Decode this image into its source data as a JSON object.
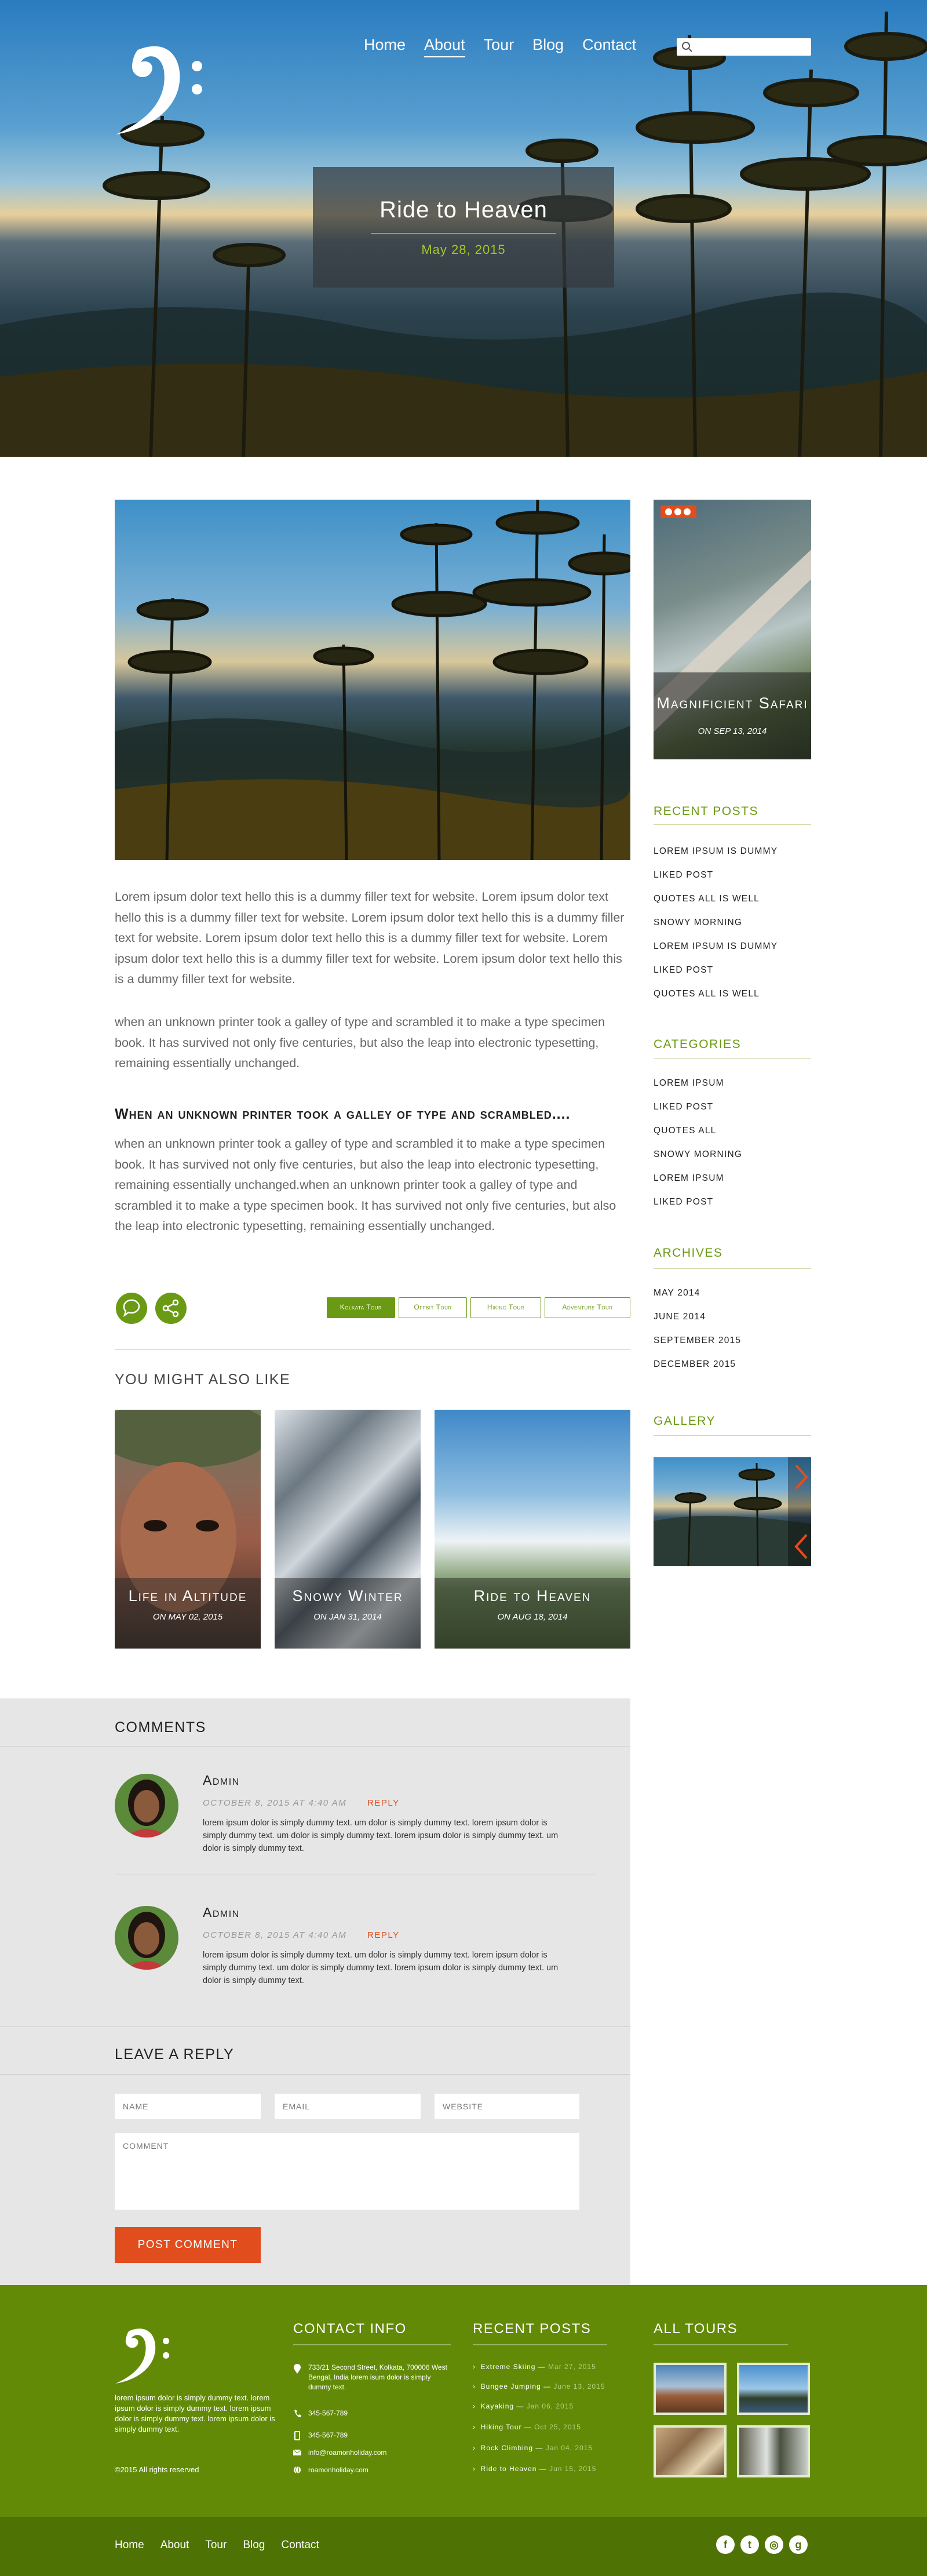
{
  "nav": {
    "items": [
      "Home",
      "About",
      "Tour",
      "Blog",
      "Contact"
    ],
    "active": "About"
  },
  "hero": {
    "title": "Ride to Heaven",
    "date": "May 28, 2015"
  },
  "post": {
    "intro": "Lorem ipsum dolor text hello this is a dummy filler text for website. Lorem ipsum dolor text hello this is a dummy filler text for website.  Lorem ipsum dolor text hello this is a dummy filler text for website. Lorem ipsum dolor text hello this is a dummy filler text for website. Lorem ipsum dolor text hello this is a dummy filler text for website.  Lorem ipsum dolor text hello this is a dummy filler text for website.",
    "para2": "when an unknown printer took a galley of type and scrambled it to make a type specimen book. It has survived not only five centuries, but also the leap into electronic typesetting, remaining essentially unchanged.",
    "heading": "When an unknown printer took a galley of type and scrambled....",
    "para3": "when an unknown printer took a galley of type and scrambled it to make a type specimen book. It has survived not only five centuries, but also the leap into electronic typesetting, remaining essentially unchanged.when an unknown printer took a galley of type and scrambled it to make a type specimen book. It has survived not only five centuries, but also the leap into electronic typesetting, remaining essentially unchanged.",
    "tags": [
      "Kolkata Tour",
      "Offbit Tour",
      "Hiking Tour",
      "Adventure Tour"
    ]
  },
  "related": {
    "heading": "YOU MIGHT ALSO LIKE",
    "items": [
      {
        "title": "Life in Altitude",
        "date": "ON MAY 02, 2015"
      },
      {
        "title": "Snowy Winter",
        "date": "ON JAN 31, 2014"
      },
      {
        "title": "Ride to Heaven",
        "date": "ON AUG 18, 2014"
      }
    ]
  },
  "sidebar": {
    "slider": {
      "title": "Magnificient Safari",
      "date": "ON SEP 13, 2014"
    },
    "recent": {
      "heading": "RECENT POSTS",
      "items": [
        "Lorem ipsum is dummy",
        "Liked post",
        "Quotes all is well",
        "Snowy morning",
        "Lorem ipsum is dummy",
        "Liked post",
        "Quotes all is well"
      ]
    },
    "categories": {
      "heading": "CATEGORIES",
      "items": [
        "Lorem ipsum",
        "Liked post",
        "Quotes all",
        "Snowy morning",
        "Lorem ipsum",
        "Liked post"
      ]
    },
    "archives": {
      "heading": "ARCHIVES",
      "items": [
        "May 2014",
        "June 2014",
        "September 2015",
        "December 2015"
      ]
    },
    "gallery": {
      "heading": "GALLERY"
    }
  },
  "comments": {
    "heading": "COMMENTS",
    "items": [
      {
        "name": "Admin",
        "date": "OCTOBER 8, 2015 AT 4:40 AM",
        "reply": "REPLY",
        "text": "lorem ipsum dolor is simply dummy text. um dolor is simply dummy text. lorem ipsum dolor is simply dummy text. um dolor is simply dummy text. lorem ipsum dolor is simply dummy text. um dolor is simply dummy text."
      },
      {
        "name": "Admin",
        "date": "OCTOBER 8, 2015 AT 4:40 AM",
        "reply": "REPLY",
        "text": "lorem ipsum dolor is simply dummy text. um dolor is simply dummy text. lorem ipsum dolor is simply dummy text. um dolor is simply dummy text. lorem ipsum dolor is simply dummy text. um dolor is simply dummy text."
      }
    ]
  },
  "reply_form": {
    "heading": "LEAVE A REPLY",
    "name_ph": "NAME",
    "email_ph": "EMAIL",
    "website_ph": "WEBSITE",
    "comment_ph": "COMMENT",
    "submit": "POST COMMENT"
  },
  "footer": {
    "about": "lorem ipsum dolor is simply dummy text. lorem ipsum dolor is simply dummy text. lorem ipsum dolor is simply dummy text. lorem ipsum dolor is simply dummy text.",
    "copyright": "©2015 All rights reserved",
    "contact": {
      "heading": "CONTACT INFO",
      "address": "733/21 Second Street, Kolkata, 700006 West Bengal, India lorem isum dolor is simply dummy text.",
      "phone1": "345-567-789",
      "phone2": "345-567-789",
      "email": "info@roamonholiday.com",
      "web": "roamonholiday.com"
    },
    "recent": {
      "heading": "RECENT POSTS",
      "items": [
        {
          "title": "Extreme Skiing",
          "date": "Mar 27, 2015"
        },
        {
          "title": "Bungee Jumping",
          "date": "June 13, 2015"
        },
        {
          "title": "Kayaking",
          "date": "Jan 06, 2015"
        },
        {
          "title": "Hiking Tour",
          "date": "Oct 25, 2015"
        },
        {
          "title": "Rock Climbing",
          "date": "Jan 04, 2015"
        },
        {
          "title": "Ride to Heaven",
          "date": "Jun 15, 2015"
        }
      ]
    },
    "tours": {
      "heading": "ALL TOURS"
    },
    "nav": [
      "Home",
      "About",
      "Tour",
      "Blog",
      "Contact"
    ]
  },
  "colors": {
    "accent": "#6a9a13",
    "footer": "#628a07",
    "footer_bar": "#4e7304",
    "cta": "#e24d1e"
  }
}
